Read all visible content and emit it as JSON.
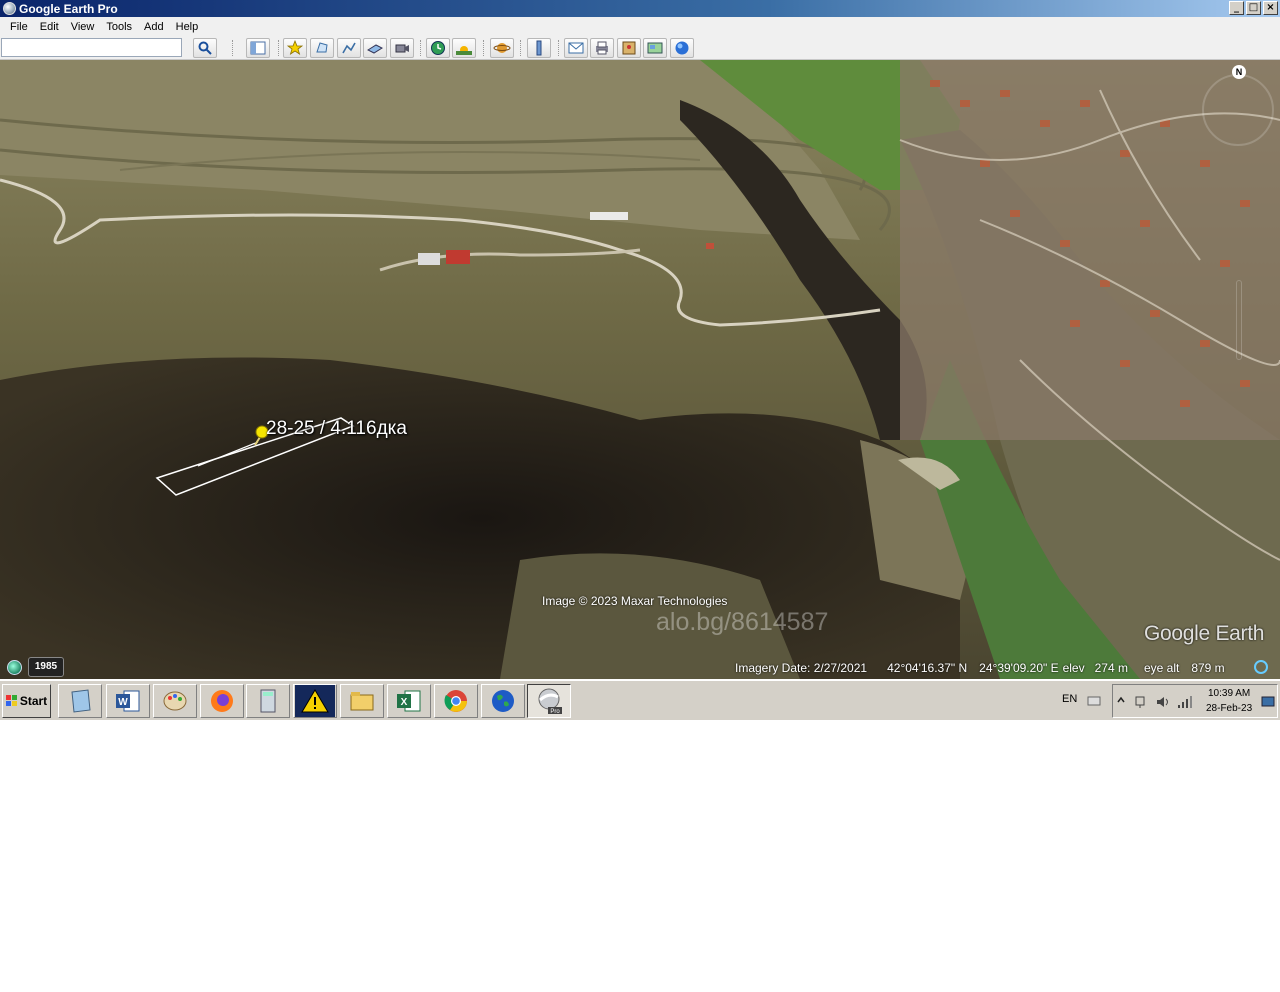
{
  "window": {
    "title": "Google Earth Pro"
  },
  "menu": [
    "File",
    "Edit",
    "View",
    "Tools",
    "Add",
    "Help"
  ],
  "search": {
    "value": "",
    "placeholder": ""
  },
  "toolbar": {
    "buttons": [
      "search-icon",
      "sidebar-icon",
      "placemark-icon",
      "polygon-icon",
      "path-icon",
      "image-overlay-icon",
      "record-tour-icon",
      "historical-imagery-icon",
      "sunlight-icon",
      "planets-icon",
      "ruler-icon",
      "email-icon",
      "print-icon",
      "save-image-icon",
      "view-in-maps-icon",
      "earth-globe-icon"
    ]
  },
  "map": {
    "placemark_label": "28-25 / 4.116дка",
    "attribution": "Image © 2023 Maxar Technologies",
    "watermark": "alo.bg/8614587",
    "logo": "Google Earth",
    "north": "N",
    "history_year": "1985"
  },
  "status": {
    "imagery_date": "Imagery Date: 2/27/2021",
    "lat": "42°04'16.37\" N",
    "lon": "24°39'09.20\" E",
    "elev_label": "elev",
    "elev_value": "274 m",
    "eye_label": "eye alt",
    "eye_value": "879 m"
  },
  "taskbar": {
    "start": "Start",
    "apps": [
      "explorer-icon",
      "word-icon",
      "paint-icon",
      "firefox-icon",
      "calculator-icon",
      "warning-icon",
      "folder-icon",
      "excel-icon",
      "chrome-icon",
      "globe-icon",
      "google-earth-pro-icon"
    ],
    "language": "EN",
    "time": "10:39 AM",
    "date": "28-Feb-23"
  },
  "colors": {
    "titlebar": "#0a246a",
    "taskbar": "#d4d0c8",
    "menubar": "#f0f0f0"
  }
}
